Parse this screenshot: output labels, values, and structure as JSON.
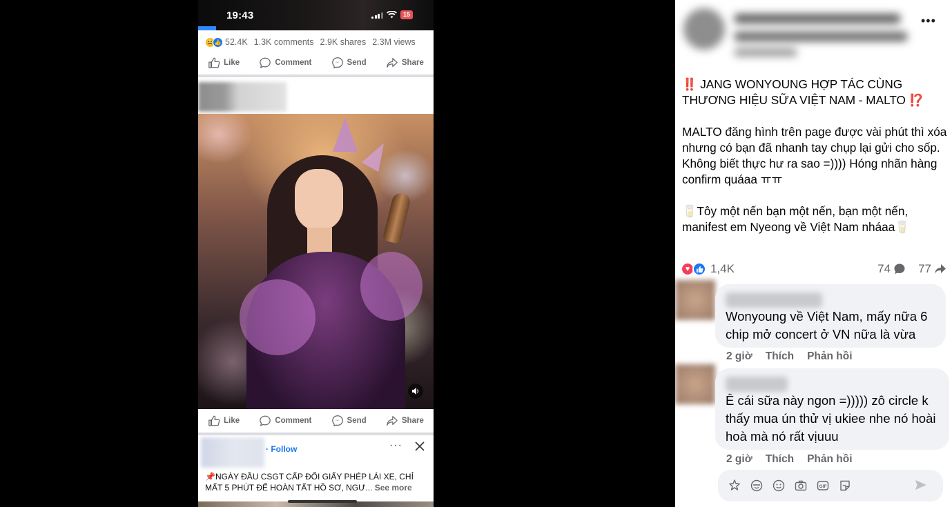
{
  "left_post": {
    "status": {
      "time": "19:43",
      "battery": "15"
    },
    "stats": {
      "reactions": "52.4K",
      "comments": "1.3K comments",
      "shares": "2.9K shares",
      "views": "2.3M views"
    },
    "actions": {
      "like": "Like",
      "comment": "Comment",
      "send": "Send",
      "share": "Share"
    },
    "ad": {
      "follow": "· Follow",
      "more": "···",
      "text": "📌NGÀY ĐẦU CSGT CẤP ĐỔI GIẤY PHÉP LÁI XE, CHỈ MẤT 5 PHÚT ĐỂ HOÀN TẤT HỒ SƠ, NGƯ...",
      "see_more": "See more"
    }
  },
  "right_post": {
    "more": "•••",
    "headline_line1": "JANG WONYOUNG HỢP TÁC CÙNG",
    "headline_line2": "THƯƠNG HIỆU SỮA VIỆT NAM - MALTO",
    "headline_start_emoji": "‼️",
    "headline_end_emoji": "⁉️",
    "paragraph1": "MALTO đăng hình trên page được vài phút thì xóa nhưng có bạn đã nhanh tay chụp lại gửi cho sốp. Không biết thực hư ra sao =)))) Hóng nhãn hàng confirm quáaa ㅠㅠ",
    "paragraph2_start": "🥛",
    "paragraph2": "Tôy một nến bạn một nến, bạn một nến, manifest em Nyeong về Việt Nam nháaa",
    "paragraph2_end": "🥛",
    "reactions": "1,4K",
    "comments_count": "74",
    "shares_count": "77",
    "comments": [
      {
        "text": "Wonyoung về Việt Nam, mấy nữa 6 chip mở concert ở VN nữa là vừa",
        "time": "2 giờ",
        "like": "Thích",
        "reply": "Phản hồi"
      },
      {
        "text": "Ê cái sữa này ngon =))))) zô circle k thấy mua ún thử vị ukiee nhe nó hoài hoà mà nó rất vịuuu",
        "time": "2 giờ",
        "like": "Thích",
        "reply": "Phản hồi"
      }
    ]
  },
  "colors": {
    "facebook_blue": "#1877f2",
    "meta_gray": "#65676b",
    "bubble_gray": "#f0f2f5",
    "love_red": "#f33e58"
  }
}
